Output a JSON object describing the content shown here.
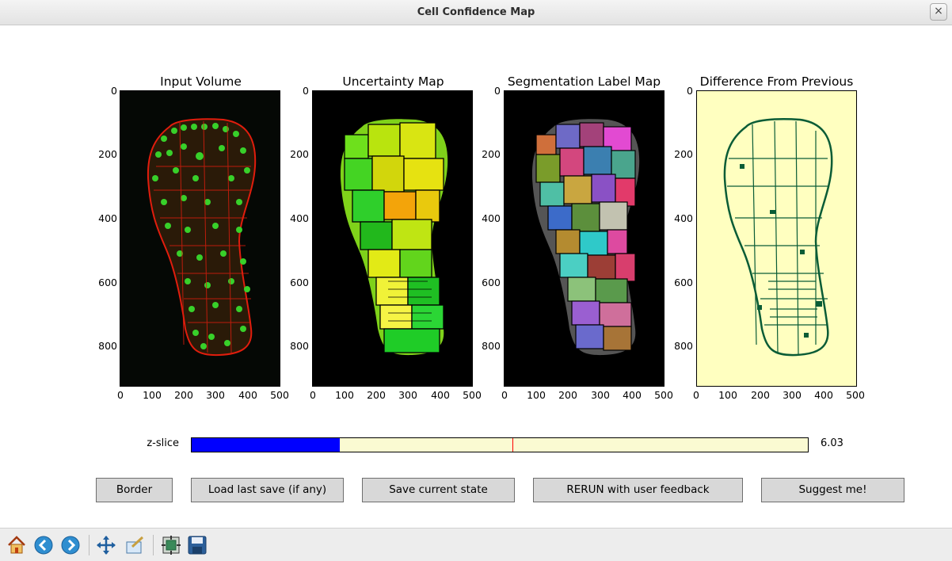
{
  "window": {
    "title": "Cell Confidence Map"
  },
  "plots": [
    {
      "title": "Input Volume"
    },
    {
      "title": "Uncertainty Map"
    },
    {
      "title": "Segmentation Label Map"
    },
    {
      "title": "Difference From Previous"
    }
  ],
  "axes": {
    "yticks": [
      "0",
      "200",
      "400",
      "600",
      "800"
    ],
    "xticks": [
      "0",
      "100",
      "200",
      "300",
      "400",
      "500"
    ]
  },
  "slider": {
    "label": "z-slice",
    "value_text": "6.03",
    "fill_fraction": 0.241,
    "initial_fraction": 0.521
  },
  "buttons": {
    "border": "Border",
    "load": "Load last save (if any)",
    "save": "Save current state",
    "rerun": "RERUN with user feedback",
    "suggest": "Suggest me!"
  },
  "toolbar": {
    "items": [
      "home-icon",
      "back-icon",
      "forward-icon",
      "pan-icon",
      "zoom-icon",
      "subplots-icon",
      "save-icon"
    ]
  },
  "colors": {
    "slider_fill": "#0000ff",
    "slider_track": "#fafad2",
    "difference_bg": "#ffffc0",
    "difference_fg": "#0a5c36"
  }
}
